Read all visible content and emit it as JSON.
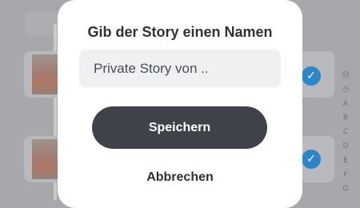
{
  "dialog": {
    "title": "Gib der Story einen Namen",
    "name_value": "Private Story von ..",
    "save_label": "Speichern",
    "cancel_label": "Abbrechen"
  },
  "background": {
    "check_glyph": "✓",
    "index_items": [
      "☺",
      "◷",
      "A",
      "B",
      "C",
      "D",
      "E",
      "F",
      "G"
    ]
  },
  "colors": {
    "overlay": "#a6a8ab",
    "save_button": "#3f4349",
    "check": "#2c86c8"
  }
}
